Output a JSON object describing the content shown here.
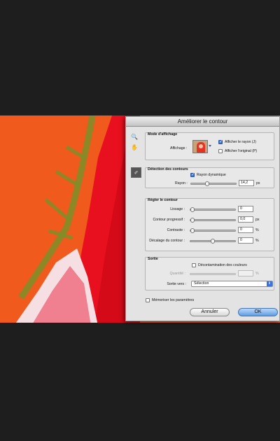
{
  "dialog": {
    "title": "Améliorer le contour"
  },
  "tools": {
    "zoom_icon": "magnifier-icon",
    "hand_icon": "hand-icon",
    "brush_icon": "refine-radius-brush-icon"
  },
  "mode_affichage": {
    "title": "Mode d'affichage",
    "affichage_label": "Affichage :",
    "afficher_rayon_label": "Afficher le rayon (J)",
    "afficher_rayon_checked": true,
    "afficher_original_label": "Afficher l'original (P)",
    "afficher_original_checked": false
  },
  "detection": {
    "title": "Détection des contours",
    "rayon_dynamique_label": "Rayon dynamique",
    "rayon_dynamique_checked": true,
    "rayon_label": "Rayon :",
    "rayon_value": "14,2",
    "rayon_unit": "px",
    "rayon_slider_fraction": 0.34
  },
  "regler": {
    "title": "Régler le contour",
    "lissage_label": "Lissage :",
    "lissage_value": "0",
    "lissage_fraction": 0.0,
    "contour_label": "Contour progressif :",
    "contour_value": "0,0",
    "contour_unit": "px",
    "contour_fraction": 0.0,
    "contraste_label": "Contraste :",
    "contraste_value": "0",
    "contraste_unit": "%",
    "contraste_fraction": 0.0,
    "decalage_label": "Décalage du contour :",
    "decalage_value": "0",
    "decalage_unit": "%",
    "decalage_fraction": 0.5
  },
  "sortie": {
    "title": "Sortie",
    "decontamination_label": "Décontamination des couleurs",
    "decontamination_checked": false,
    "quantite_label": "Quantité :",
    "quantite_value": "",
    "quantite_unit": "%",
    "sortie_vers_label": "Sortie vers :",
    "sortie_vers_value": "Sélection"
  },
  "memoriser": {
    "label": "Mémoriser les paramètres",
    "checked": false
  },
  "buttons": {
    "cancel": "Annuler",
    "ok": "OK"
  },
  "colors": {
    "accent": "#3b73d6",
    "photo_orange": "#f2561a",
    "hair_red": "#e8101e"
  }
}
